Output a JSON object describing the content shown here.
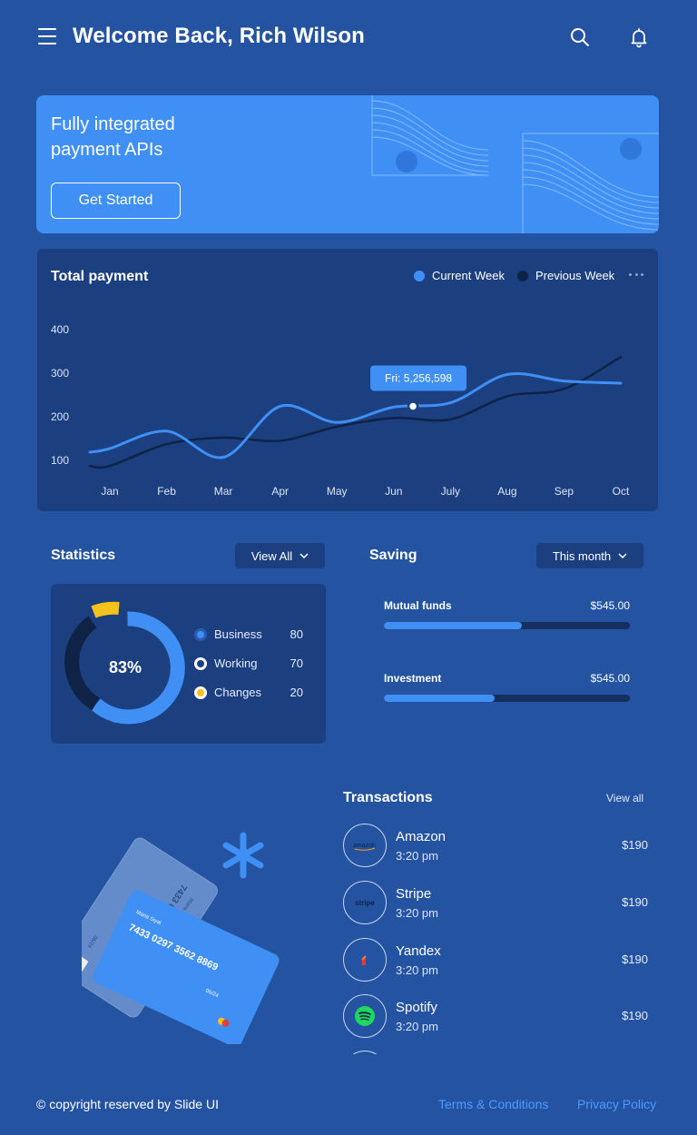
{
  "header": {
    "title": "Welcome Back, Rich Wilson",
    "icons": [
      "menu-icon",
      "search-icon",
      "bell-icon"
    ]
  },
  "banner": {
    "title": "Fully integrated\npayment APIs",
    "button_label": "Get Started"
  },
  "payment_chart": {
    "title": "Total payment",
    "legend": {
      "current": "Current Week",
      "previous": "Previous Week"
    },
    "tooltip": "Fri: 5,256,598"
  },
  "chart_data": {
    "type": "line",
    "categories": [
      "Jan",
      "Feb",
      "Mar",
      "Apr",
      "May",
      "Jun",
      "July",
      "Aug",
      "Sep",
      "Oct"
    ],
    "ylim": [
      100,
      400
    ],
    "yticks": [
      100,
      200,
      300,
      400
    ],
    "series": [
      {
        "name": "Current Week",
        "color": "#3f8ff4",
        "values": [
          125,
          165,
          105,
          222,
          185,
          220,
          230,
          295,
          280,
          275
        ]
      },
      {
        "name": "Previous Week",
        "color": "#0f2347",
        "values": [
          85,
          135,
          150,
          143,
          175,
          195,
          192,
          245,
          262,
          335
        ]
      }
    ],
    "highlight": {
      "series": "Current Week",
      "label": "Fri: 5,256,598"
    },
    "grid": false,
    "legend_position": "top-right"
  },
  "statistics": {
    "title": "Statistics",
    "dropdown_label": "View All",
    "center_value": "83%",
    "donut_percent": 83,
    "items": [
      {
        "label": "Business",
        "value": "80"
      },
      {
        "label": "Working",
        "value": "70"
      },
      {
        "label": "Changes",
        "value": "20"
      }
    ]
  },
  "saving": {
    "title": "Saving",
    "dropdown_label": "This month",
    "items": [
      {
        "label": "Mutual funds",
        "amount": "$545.00",
        "progress": 0.56
      },
      {
        "label": "Investment",
        "amount": "$545.00",
        "progress": 0.45
      }
    ]
  },
  "cards": {
    "front": {
      "holder": "Maria Siyal",
      "number": "7433 0297 3562 8869",
      "expiry": "06/24"
    },
    "back": {
      "holder": "Maria Siyal",
      "number": "7433 0297 3562 8869",
      "expiry": "06/24"
    }
  },
  "transactions": {
    "title": "Transactions",
    "view_all": "View all",
    "items": [
      {
        "name": "Amazon",
        "time": "3:20 pm",
        "amount": "$190",
        "logo_text": "amazon"
      },
      {
        "name": "Stripe",
        "time": "3:20 pm",
        "amount": "$190",
        "logo_text": "stripe"
      },
      {
        "name": "Yandex",
        "time": "3:20 pm",
        "amount": "$190"
      },
      {
        "name": "Spotify",
        "time": "3:20 pm",
        "amount": "$190"
      }
    ]
  },
  "footer": {
    "copyright": "© copyright reserved by Slide UI",
    "terms": "Terms & Conditions",
    "privacy": "Privacy Policy"
  },
  "colors": {
    "background": "#2453a1",
    "card": "#1c3f80",
    "accent": "#3f8ff4",
    "yellow": "#f5c21b",
    "link": "#4f9bff"
  }
}
